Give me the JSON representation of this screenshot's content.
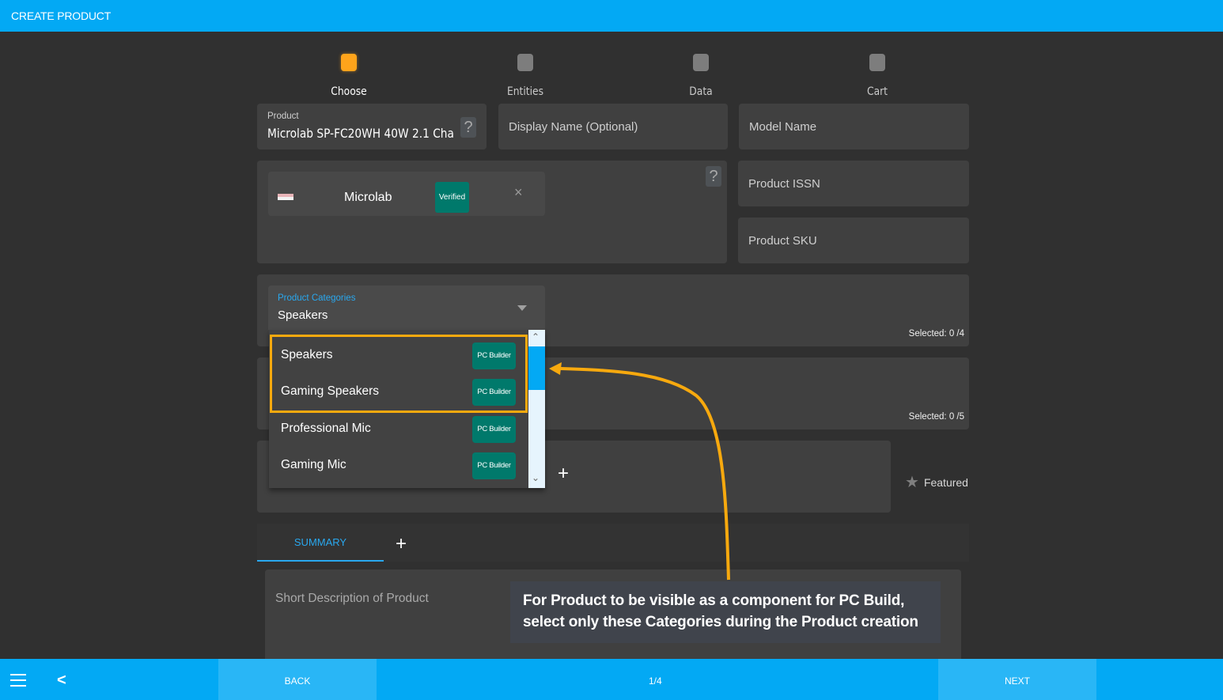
{
  "header": {
    "title": "CREATE PRODUCT"
  },
  "stepper": {
    "steps": [
      {
        "label": "Choose",
        "active": true
      },
      {
        "label": "Entities",
        "active": false
      },
      {
        "label": "Data",
        "active": false
      },
      {
        "label": "Cart",
        "active": false
      }
    ],
    "active_color": "#ffa41b"
  },
  "form": {
    "product": {
      "label": "Product",
      "value": "Microlab SP-FC20WH 40W 2.1 Cha"
    },
    "display_name": {
      "placeholder": "Display Name (Optional)"
    },
    "model_name": {
      "placeholder": "Model Name"
    },
    "product_issn": {
      "placeholder": "Product ISSN"
    },
    "product_sku": {
      "placeholder": "Product SKU"
    },
    "help_icon": "?",
    "brand": {
      "name": "Microlab",
      "badge": "Verified",
      "remove_icon": "×"
    },
    "categories": {
      "label": "Product Categories",
      "value": "Speakers",
      "selected_counter": "Selected: 0 /4",
      "options": [
        {
          "name": "Speakers",
          "badge": "PC Builder"
        },
        {
          "name": "Gaming Speakers",
          "badge": "PC Builder"
        },
        {
          "name": "Professional Mic",
          "badge": "PC Builder"
        },
        {
          "name": "Gaming Mic",
          "badge": "PC Builder"
        }
      ]
    },
    "second_counter": "Selected: 0 /5",
    "add_icon": "+",
    "featured": {
      "label": "Featured",
      "icon": "star-icon"
    }
  },
  "tabs": {
    "items": [
      {
        "label": "SUMMARY",
        "active": true
      }
    ],
    "add_icon": "+"
  },
  "description": {
    "placeholder": "Short Description of Product"
  },
  "annotation": {
    "text_line1": "For Product to be visible as a component for PC Build,",
    "text_line2": "select only these Categories during the Product creation",
    "color": "#f7a90e"
  },
  "footer": {
    "back_label": "BACK",
    "pager": "1/4",
    "next_label": "NEXT"
  },
  "colors": {
    "primary": "#03a9f4",
    "badge_teal": "#00796b"
  }
}
